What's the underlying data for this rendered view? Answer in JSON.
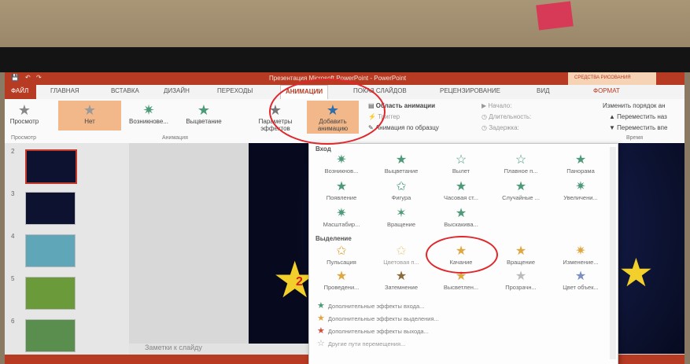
{
  "window": {
    "title": "Презентация Microsoft PowerPoint - PowerPoint",
    "context_header": "СРЕДСТВА РИСОВАНИЯ"
  },
  "tabs": [
    "ФАЙЛ",
    "ГЛАВНАЯ",
    "ВСТАВКА",
    "ДИЗАЙН",
    "ПЕРЕХОДЫ",
    "АНИМАЦИИ",
    "ПОКАЗ СЛАЙДОВ",
    "РЕЦЕНЗИРОВАНИЕ",
    "ВИД",
    "ФОРМАТ"
  ],
  "ribbon": {
    "preview": "Просмотр",
    "none": "Нет",
    "appear": "Возникнове...",
    "fade": "Выцветание",
    "effect_params": "Параметры эффектов",
    "add_animation_1": "Добавить",
    "add_animation_2": "анимацию",
    "animation_pane": "Область анимации",
    "trigger": "Триггер",
    "painter": "Анимация по образцу",
    "start": "Начало:",
    "duration": "Длительность:",
    "delay": "Задержка:",
    "reorder": "Изменить порядок ан",
    "move_earlier": "Переместить наз",
    "move_later": "Переместить впе",
    "group_preview": "Просмотр",
    "group_animation": "Анимация",
    "group_timing": "Время"
  },
  "slides": [
    "2",
    "3",
    "4",
    "5",
    "6"
  ],
  "slide_badge": "2",
  "notes": "Заметки к слайду",
  "gallery": {
    "entrance_header": "Вход",
    "entrance": [
      "Возникнов...",
      "Выцветание",
      "Вылет",
      "Плавное п...",
      "Панорама",
      "Появление",
      "Фигура",
      "Часовая ст...",
      "Случайные ...",
      "Увеличени...",
      "Масштабир...",
      "Вращение",
      "Выскакива..."
    ],
    "emphasis_header": "Выделение",
    "emphasis": [
      "Пульсация",
      "Цветовая п...",
      "Качание",
      "Вращение",
      "Изменение...",
      "Проведени...",
      "Затемнение",
      "Высветлен...",
      "Прозрачн...",
      "Цвет объек..."
    ],
    "more": [
      "Дополнительные эффекты входа...",
      "Дополнительные эффекты выделения...",
      "Дополнительные эффекты выхода...",
      "Другие пути перемещения..."
    ]
  },
  "colors": {
    "accent": "#b73a22",
    "annotation": "#e0272c",
    "entrance_star": "#4c9a78",
    "emphasis_star": "#e0a640"
  }
}
